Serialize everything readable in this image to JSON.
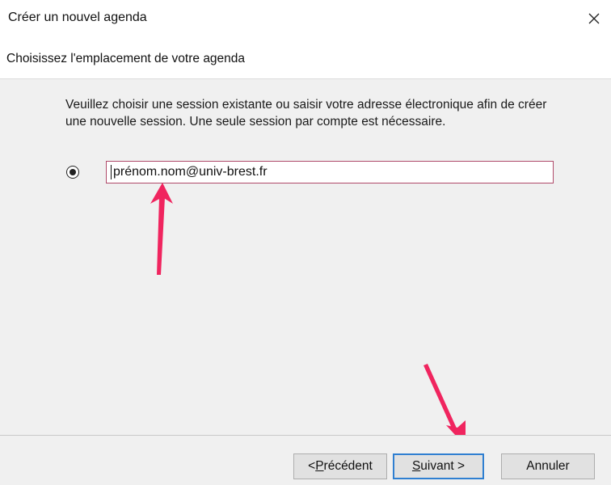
{
  "window": {
    "title": "Créer un nouvel agenda"
  },
  "header": {
    "subtitle": "Choisissez l'emplacement de votre agenda"
  },
  "content": {
    "description": "Veuillez choisir une session existante ou saisir votre adresse électronique afin de créer une nouvelle session. Une seule session par compte est nécessaire.",
    "email_value": "prénom.nom@univ-brest.fr",
    "radio_selected": true
  },
  "footer": {
    "previous_prefix": "< ",
    "previous_underlined": "P",
    "previous_rest": "récédent",
    "next_underlined": "S",
    "next_rest": "uivant >",
    "cancel_label": "Annuler"
  },
  "colors": {
    "annotation_arrow": "#f0255f",
    "focus_border": "#2f7fd1",
    "field_border": "#b04a6a"
  },
  "icons": {
    "close": "close-icon",
    "arrow": "annotation-arrow-icon"
  }
}
